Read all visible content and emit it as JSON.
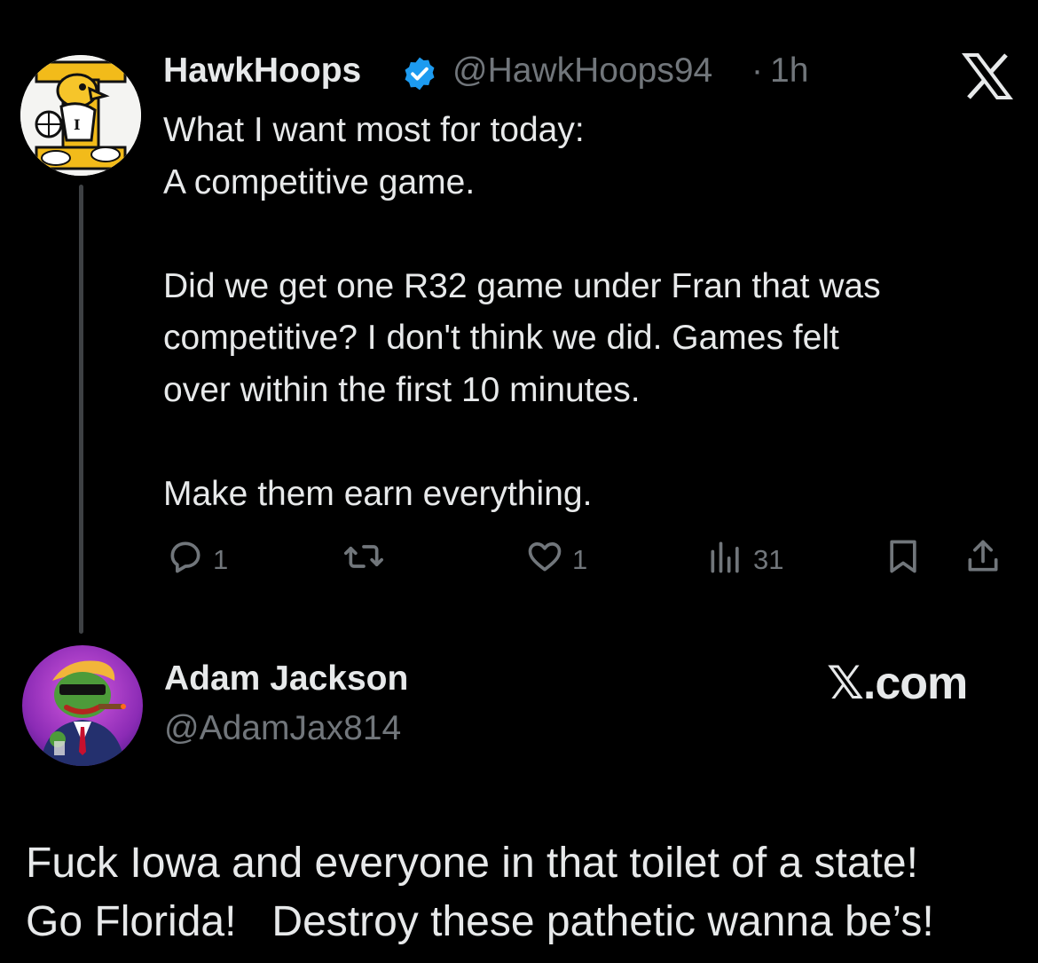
{
  "tweet": {
    "author_name": "HawkHoops",
    "handle": "@HawkHoops94",
    "separator": "·",
    "time": "1h",
    "body_lines": [
      "What I want most for today:",
      "A competitive game.",
      "",
      "Did we get one R32 game under Fran that was",
      "competitive? I don't think we did. Games felt",
      "over within the first 10 minutes.",
      "",
      "Make them earn everything."
    ],
    "actions": {
      "reply_count": "1",
      "like_count": "1",
      "views_count": "31"
    }
  },
  "reply": {
    "author_name": "Adam Jackson",
    "handle": "@AdamJax814",
    "site_label": "𝕏.com",
    "body_lines": [
      "Fuck Iowa and everyone in that toilet of a state!",
      "Go Florida!   Destroy these pathetic wanna be’s!"
    ]
  },
  "colors": {
    "background": "#000000",
    "text_primary": "#e7e9ea",
    "text_secondary": "#71767b",
    "verified_blue": "#1d9bf0",
    "thread_line": "#3e4144"
  },
  "icons": [
    "x-logo-icon",
    "verified-badge-icon",
    "reply-icon",
    "retweet-icon",
    "like-icon",
    "views-icon",
    "bookmark-icon",
    "share-icon"
  ]
}
